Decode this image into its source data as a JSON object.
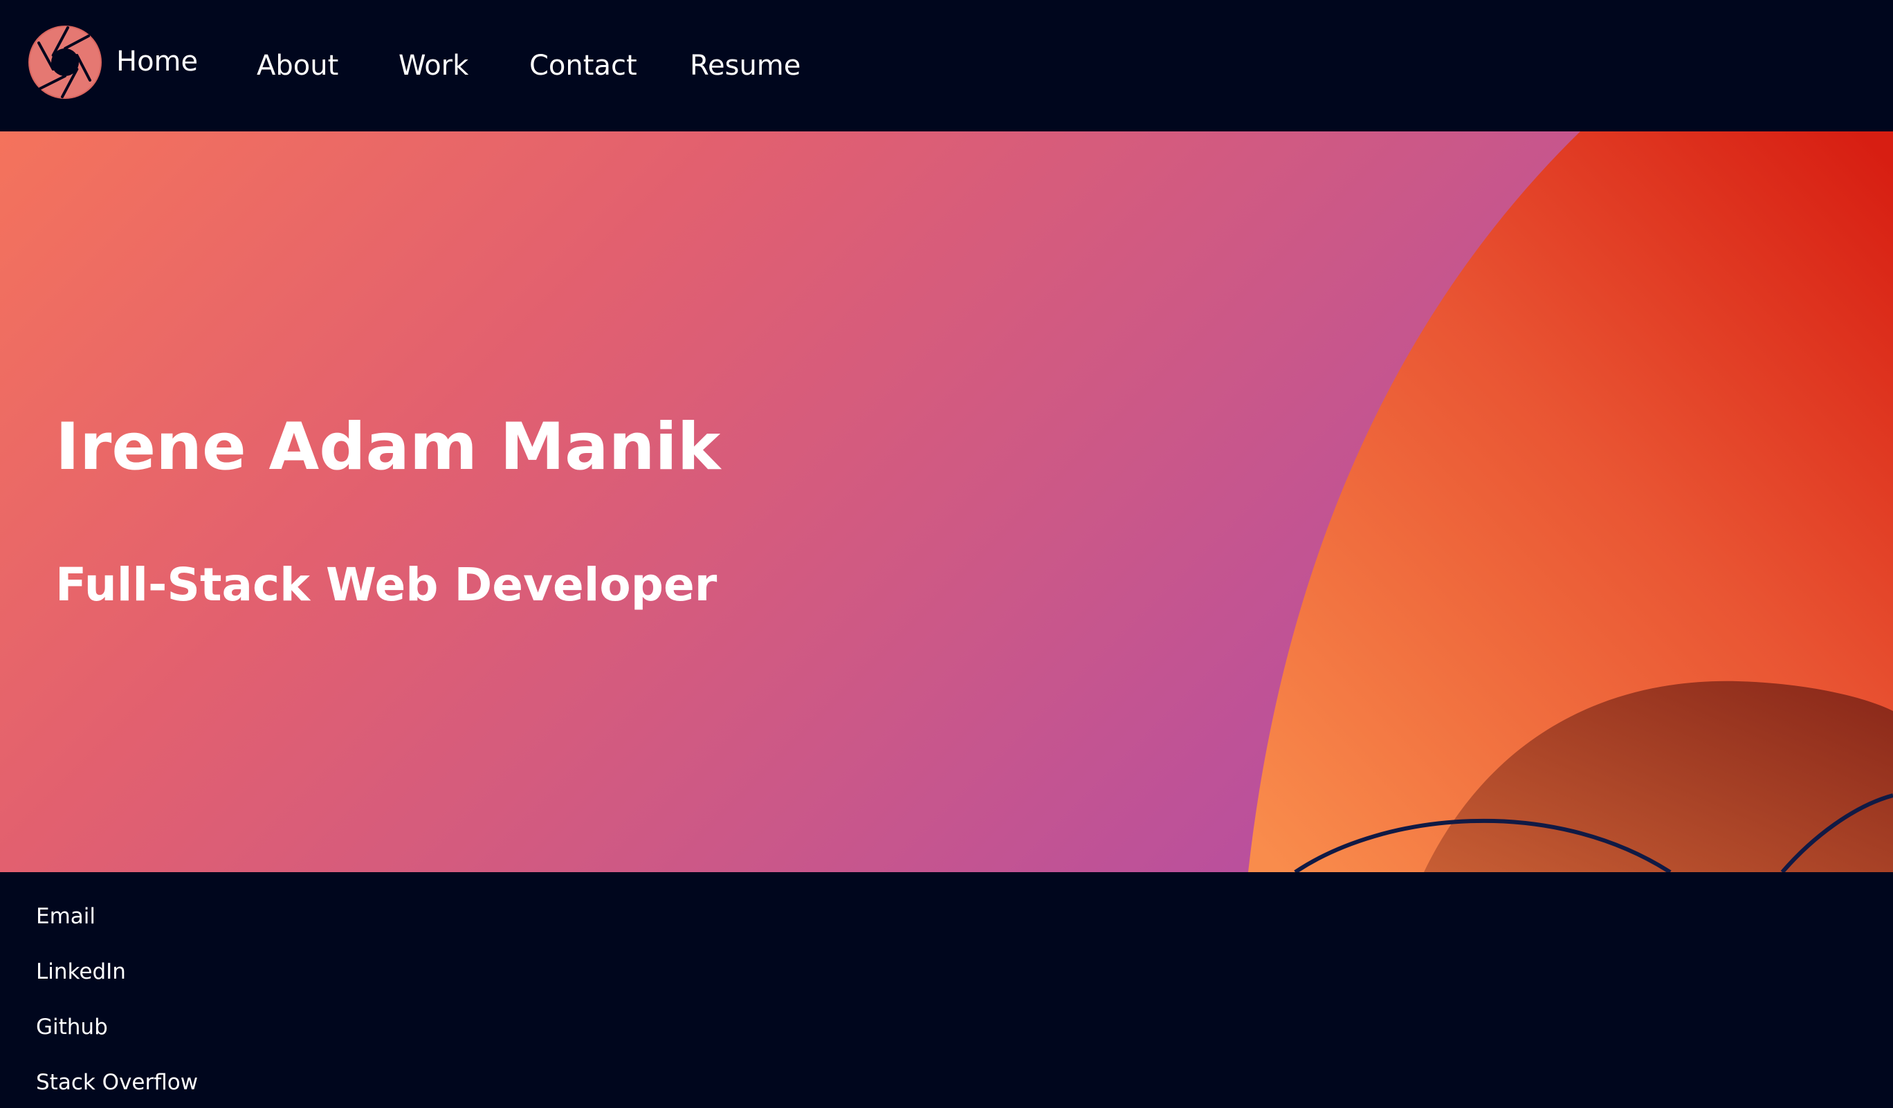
{
  "nav": {
    "logo_icon": "camera-aperture-icon",
    "items": [
      {
        "label": "Home"
      },
      {
        "label": "About"
      },
      {
        "label": "Work"
      },
      {
        "label": "Contact"
      },
      {
        "label": "Resume"
      }
    ]
  },
  "hero": {
    "name": "Irene Adam Manik",
    "role": "Full-Stack Web Developer"
  },
  "footer": {
    "links": [
      {
        "label": "Email"
      },
      {
        "label": "LinkedIn"
      },
      {
        "label": "Github"
      },
      {
        "label": "Stack Overflow"
      }
    ]
  },
  "colors": {
    "background": "#00061d",
    "hero_gradient_start": "#f4735c",
    "hero_gradient_end": "#b04ba8",
    "sun_orange": "#f7864a",
    "sun_red": "#d92213",
    "logo_pink": "#e57872",
    "text": "#ffffff"
  }
}
